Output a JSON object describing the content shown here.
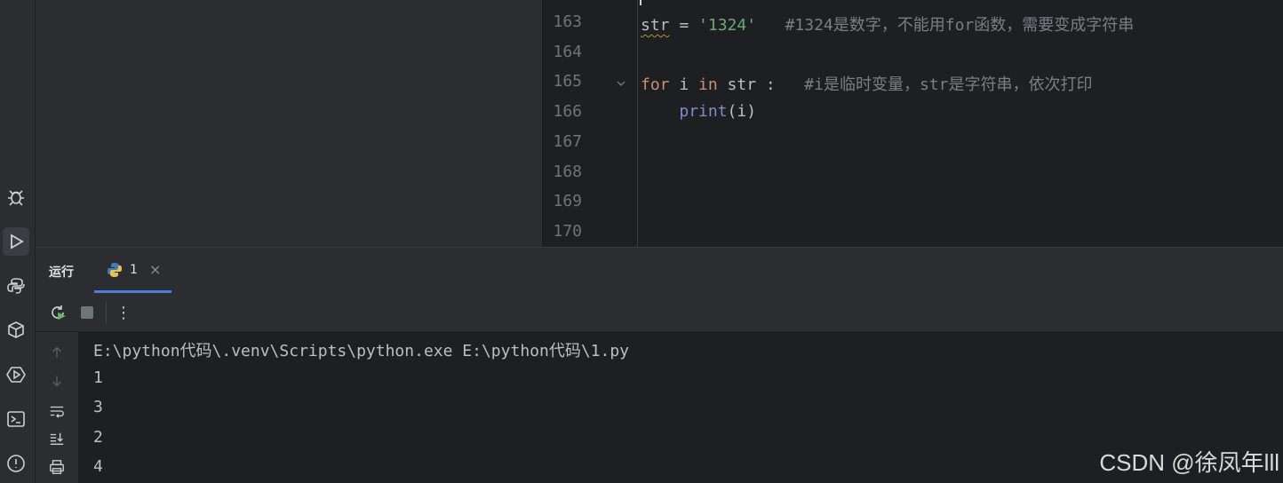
{
  "editor": {
    "lines": [
      {
        "num": "163",
        "tokens": [
          {
            "t": "str",
            "c": "squiggle"
          },
          {
            "t": " = ",
            "c": ""
          },
          {
            "t": "'1324'",
            "c": "str"
          },
          {
            "t": "   #1324是数字，不能用for函数，需要变成字符串",
            "c": "cmt"
          }
        ]
      },
      {
        "num": "164",
        "tokens": []
      },
      {
        "num": "165",
        "tokens": [
          {
            "t": "for",
            "c": "kw"
          },
          {
            "t": " i ",
            "c": ""
          },
          {
            "t": "in",
            "c": "kw"
          },
          {
            "t": " str :   ",
            "c": ""
          },
          {
            "t": "#i是临时变量，str是字符串，依次打印",
            "c": "cmt"
          }
        ]
      },
      {
        "num": "166",
        "tokens": [
          {
            "t": "    ",
            "c": ""
          },
          {
            "t": "print",
            "c": "bi"
          },
          {
            "t": "(i)",
            "c": ""
          }
        ]
      },
      {
        "num": "167",
        "tokens": []
      },
      {
        "num": "168",
        "tokens": []
      },
      {
        "num": "169",
        "tokens": []
      },
      {
        "num": "170",
        "tokens": []
      }
    ]
  },
  "run_panel": {
    "title": "运行",
    "tab_label": "1",
    "tab_close": "×",
    "more_label": "⋮"
  },
  "console": {
    "lines": [
      "E:\\python代码\\.venv\\Scripts\\python.exe E:\\python代码\\1.py",
      "1",
      "3",
      "2",
      "4"
    ]
  },
  "watermark": "CSDN @徐凤年lll",
  "colors": {
    "keyword": "#cf8e6d",
    "string": "#6aab73",
    "comment": "#7a7e85",
    "builtin": "#8888c6",
    "tab_underline": "#4a7ee3"
  }
}
